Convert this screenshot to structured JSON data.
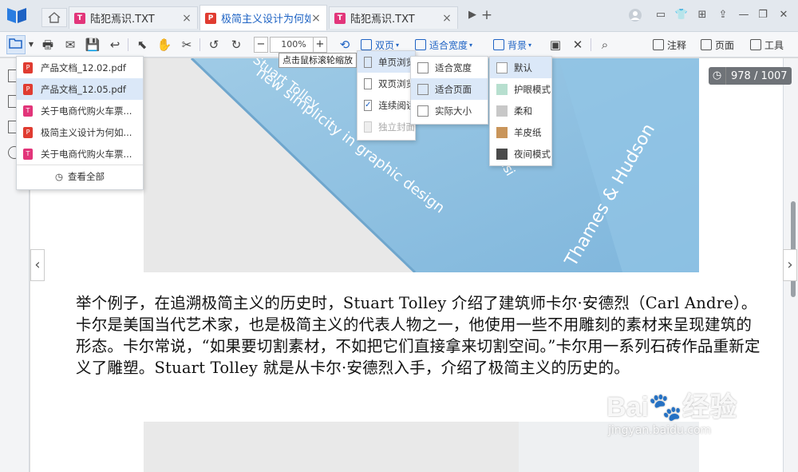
{
  "tabs": [
    {
      "label": "陆犯焉识.TXT",
      "type": "T",
      "color": "#e2357a"
    },
    {
      "label": "极简主义设计为何如",
      "type": "P",
      "color": "#e03c31"
    },
    {
      "label": "陆犯焉识.TXT",
      "type": "T",
      "color": "#e2357a"
    }
  ],
  "toolbar": {
    "zoom": "100%",
    "double_page": "双页",
    "fit_width": "适合宽度",
    "background": "背景",
    "annotate": "注释",
    "page": "页面",
    "tools": "工具"
  },
  "tooltip": "点击鼠标滚轮缩放",
  "recent_files": [
    {
      "name": "产品文档_12.02.pdf",
      "type": "P"
    },
    {
      "name": "产品文档_12.05.pdf",
      "type": "P"
    },
    {
      "name": "关于电商代购火车票...",
      "type": "T"
    },
    {
      "name": "极简主义设计为何如...",
      "type": "P"
    },
    {
      "name": "关于电商代购火车票...",
      "type": "T"
    }
  ],
  "view_all": "查看全部",
  "view_menu": [
    "单页浏览",
    "双页浏览",
    "连续阅读",
    "独立封面"
  ],
  "fit_menu": [
    "适合宽度",
    "适合页面",
    "实际大小"
  ],
  "bg_menu": [
    {
      "label": "默认",
      "color": "#ffffff"
    },
    {
      "label": "护眼模式",
      "color": "#b7dfcf"
    },
    {
      "label": "柔和",
      "color": "#c8c8c8"
    },
    {
      "label": "羊皮纸",
      "color": "#c9955a"
    },
    {
      "label": "夜间模式",
      "color": "#4a4a4a"
    }
  ],
  "page_counter": "978 / 1007",
  "book_lines": [
    "new simplicity in graphic design",
    "Stuart Tolley",
    "Thames & Hudson",
    "desi"
  ],
  "body_text": "举个例子，在追溯极简主义的历史时，Stuart Tolley 介绍了建筑师卡尔·安德烈（Carl Andre）。卡尔是美国当代艺术家，也是极简主义的代表人物之一，他使用一些不用雕刻的素材来呈现建筑的形态。卡尔常说，“如果要切割素材，不如把它们直接拿来切割空间。”卡尔用一系列石砖作品重新定义了雕塑。Stuart Tolley 就是从卡尔·安德烈入手，介绍了极简主义的历史的。",
  "watermark": {
    "brand": "Bai",
    "brand2": "经验",
    "url": "jingyan.baidu.com"
  }
}
